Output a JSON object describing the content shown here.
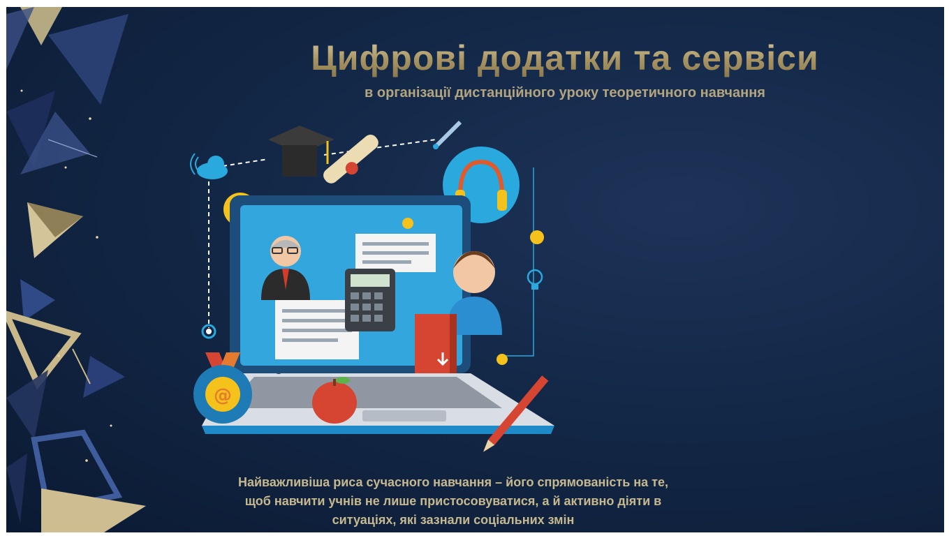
{
  "slide": {
    "title": "Цифрові додатки та сервіси",
    "subtitle": "в організації дистанційного уроку теоретичного навчання",
    "caption": "Найважливіша риса сучасного навчання – його спрямованість на те, щоб навчити учнів не лише пристосовуватися, а й активно діяти в ситуаціях, які зазнали соціальних змін",
    "illustration_icon": "online-learning-laptop-illustration",
    "decoration_icon": "geometric-triangles-decoration"
  },
  "colors": {
    "background": "#132847",
    "title_gold": "#b8a77a",
    "accent_blue": "#29a9de",
    "accent_yellow": "#f5c21b"
  }
}
